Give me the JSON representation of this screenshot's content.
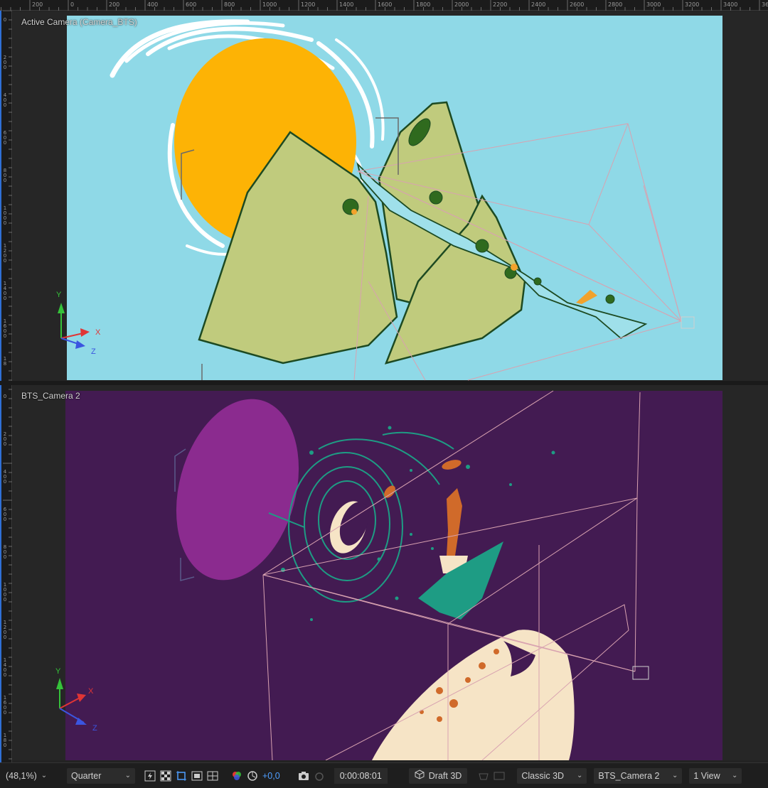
{
  "ruler_top_labels": [
    "200",
    "0",
    "200",
    "400",
    "600",
    "800",
    "1000",
    "1200",
    "1400",
    "1600",
    "1800",
    "2000",
    "2200",
    "2400",
    "2600",
    "2800",
    "3000",
    "3200",
    "3400",
    "36"
  ],
  "ruler_left_labels_top": [
    "0",
    "200",
    "400",
    "600",
    "800",
    "1000",
    "1200",
    "1400",
    "1600",
    "18"
  ],
  "ruler_left_labels_bottom": [
    "0",
    "200",
    "400",
    "600",
    "800",
    "1000",
    "1200",
    "1400",
    "1600",
    "180"
  ],
  "top_view": {
    "title": "Active Camera (Camera_BTS)"
  },
  "bottom_view": {
    "title": "BTS_Camera 2"
  },
  "axis": {
    "y": "Y",
    "x": "X",
    "z": "Z"
  },
  "toolbar": {
    "magnification": "(48,1%)",
    "resolution": "Quarter",
    "exposure": "+0,0",
    "timecode": "0:00:08:01",
    "draft3d": "Draft 3D",
    "renderer": "Classic 3D",
    "camera_view": "BTS_Camera 2",
    "view_layout": "1 View"
  },
  "colors": {
    "sky": "#8fd9e7",
    "sun": "#fdb305",
    "mountain": "#c0cb7d",
    "mountain_outline": "#1d4a22",
    "night": "#431b52",
    "planet": "#8b2b8f",
    "moon": "#f6e4c6",
    "teal": "#1e9c84",
    "accent_blue": "#4f9eff"
  },
  "icons": [
    "chevron-down-icon",
    "fast-preview-icon",
    "transparency-grid-icon",
    "region-of-interest-icon",
    "safe-zones-icon",
    "grid-guides-icon",
    "rgb-channels-icon",
    "exposure-reset-icon",
    "snapshot-camera-icon",
    "show-snapshot-icon",
    "draft-3d-icon",
    "3d-ground-plane-icon",
    "extended-viewer-icon"
  ]
}
